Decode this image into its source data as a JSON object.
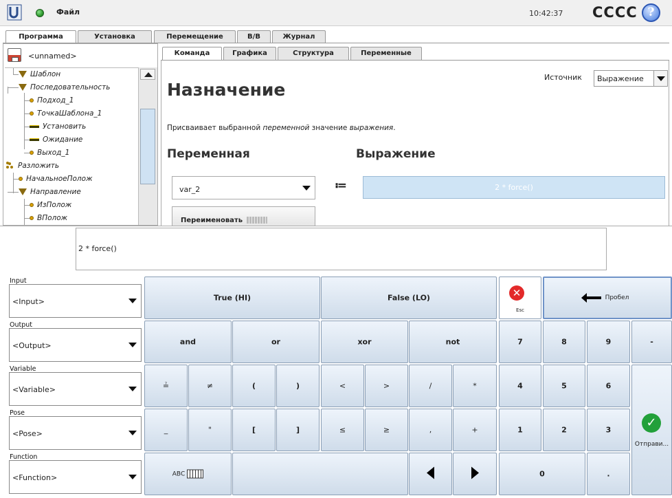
{
  "header": {
    "file_menu": "Файл",
    "clock": "10:42:37",
    "robot_name": "CCCC",
    "help": "?"
  },
  "main_tabs": [
    "Программа",
    "Установка",
    "Перемещение",
    "В/В",
    "Журнал"
  ],
  "program": {
    "name": "<unnamed>",
    "tree": [
      {
        "label": "Шаблон",
        "icon": "triangle-icon"
      },
      {
        "label": "Последовательность",
        "icon": "triangle-icon"
      },
      {
        "label": "Подход_1",
        "icon": "waypoint-icon"
      },
      {
        "label": "ТочкаШаблона_1",
        "icon": "waypoint-icon"
      },
      {
        "label": "Установить",
        "icon": "set-icon"
      },
      {
        "label": "Ожидание",
        "icon": "wait-icon"
      },
      {
        "label": "Выход_1",
        "icon": "waypoint-icon"
      },
      {
        "label": "Разложить",
        "icon": "scatter-icon"
      },
      {
        "label": "НачальноеПолож",
        "icon": "waypoint-icon"
      },
      {
        "label": "Направление",
        "icon": "triangle-icon"
      },
      {
        "label": "ИзПолож",
        "icon": "waypoint-icon"
      },
      {
        "label": "ВПолож",
        "icon": "waypoint-icon"
      }
    ]
  },
  "sub_tabs": [
    "Команда",
    "Графика",
    "Структура",
    "Переменные"
  ],
  "command": {
    "title": "Назначение",
    "source_label": "Источник",
    "source_value": "Выражение",
    "desc_prefix": "Присваивает выбранной ",
    "desc_var": "переменной",
    "desc_mid": " значение ",
    "desc_expr": "выражения",
    "desc_suffix": ".",
    "variable_heading": "Переменная",
    "expression_heading": "Выражение",
    "variable_value": "var_2",
    "assign_symbol": "≔",
    "expression_value": "2 * force()",
    "rename_label": "Переименовать"
  },
  "keyboard": {
    "input_text": "2 * force()",
    "selectors": [
      {
        "label": "Input",
        "value": "<Input>"
      },
      {
        "label": "Output",
        "value": "<Output>"
      },
      {
        "label": "Variable",
        "value": "<Variable>"
      },
      {
        "label": "Pose",
        "value": "<Pose>"
      },
      {
        "label": "Function",
        "value": "<Function>"
      }
    ],
    "keys": {
      "true": "True (HI)",
      "false": "False (LO)",
      "esc": "Esc",
      "space": "Пробел",
      "and": "and",
      "or": "or",
      "xor": "xor",
      "not": "not",
      "k7": "7",
      "k8": "8",
      "k9": "9",
      "dash": "-",
      "le_eq": "≟",
      "ne": "≠",
      "lparen": "(",
      "rparen": ")",
      "lt": "<",
      "gt": ">",
      "slash": "/",
      "star": "*",
      "k4": "4",
      "k5": "5",
      "k6": "6",
      "underscore": "_",
      "quote": "\"",
      "lbr": "[",
      "rbr": "]",
      "le": "≤",
      "ge": "≥",
      "comma": ",",
      "plus": "+",
      "k1": "1",
      "k2": "2",
      "k3": "3",
      "send": "Отправи...",
      "abc": "ABC",
      "k0": "0",
      "dot": "."
    }
  }
}
